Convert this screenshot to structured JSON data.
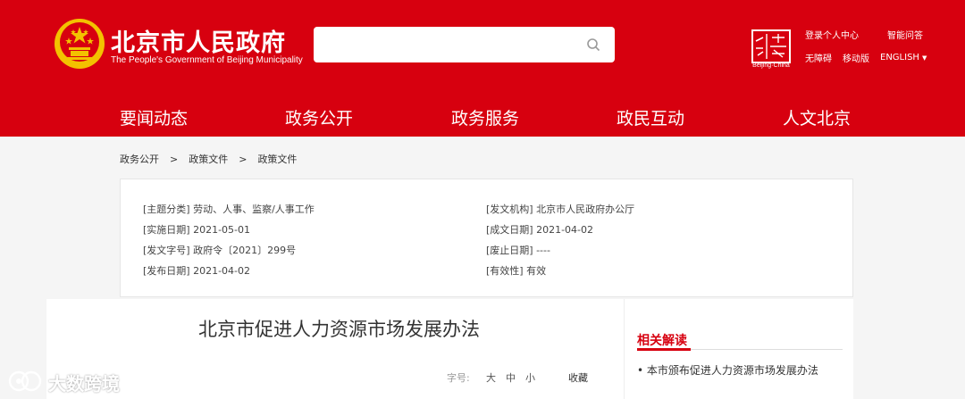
{
  "header": {
    "title": "北京市人民政府",
    "subtitle": "The People's Government of Beijing Municipality",
    "seal_caption": "Beijing·China",
    "links": {
      "login": "登录个人中心",
      "qa": "智能问答",
      "accessible": "无障碍",
      "mobile": "移动版",
      "lang": "ENGLISH"
    }
  },
  "search": {
    "placeholder": ""
  },
  "nav": [
    "要闻动态",
    "政务公开",
    "政务服务",
    "政民互动",
    "人文北京"
  ],
  "breadcrumb": [
    "政务公开",
    "政策文件",
    "政策文件"
  ],
  "breadcrumb_sep": ">",
  "doc_info": {
    "left": [
      "[主题分类] 劳动、人事、监察/人事工作",
      "[实施日期] 2021-05-01",
      "[发文字号] 政府令〔2021〕299号",
      "[发布日期] 2021-04-02"
    ],
    "right": [
      "[发文机构] 北京市人民政府办公厅",
      "[成文日期] 2021-04-02",
      "[废止日期] ----",
      "[有效性] 有效"
    ]
  },
  "article": {
    "title": "北京市促进人力资源市场发展办法",
    "font_label": "字号:",
    "font_sizes": [
      "大",
      "中",
      "小"
    ],
    "favorite": "收藏"
  },
  "sidebar": {
    "title": "相关解读",
    "items": [
      "• 本市颁布促进人力资源市场发展办法"
    ]
  },
  "watermark": {
    "text": "大数跨境"
  },
  "colors": {
    "brand_red": "#d7000f",
    "gold": "#f3c200"
  }
}
